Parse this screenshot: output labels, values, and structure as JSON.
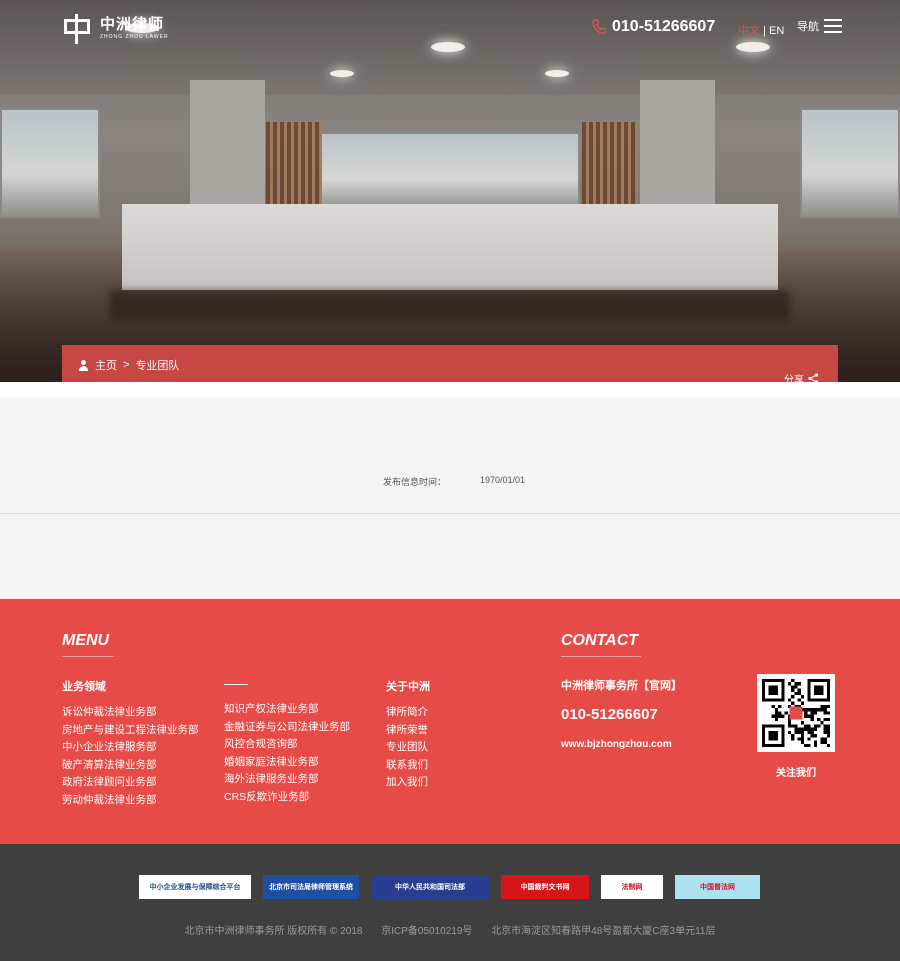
{
  "header": {
    "logo_cn": "中洲律师",
    "logo_en": "ZHONG ZHOU LAWER",
    "phone": "010-51266607",
    "lang_cn": "中文",
    "lang_sep": "|",
    "lang_en": "EN",
    "nav_label": "导航"
  },
  "breadcrumb": {
    "home": "主页",
    "sep": ">",
    "current": "专业团队",
    "share": "分享"
  },
  "content": {
    "publish_label": "发布信息时间：",
    "publish_date": "1970/01/01"
  },
  "footer": {
    "menu_title": "MENU",
    "contact_title": "CONTACT",
    "col1": {
      "title": "业务领域",
      "items": [
        "诉讼仲裁法律业务部",
        "房地产与建设工程法律业务部",
        "中小企业法律服务部",
        "破产清算法律业务部",
        "政府法律顾问业务部",
        "劳动仲裁法律业务部"
      ]
    },
    "col2": {
      "items": [
        "知识产权法律业务部",
        "金融证券与公司法律业务部",
        "风控合规咨询部",
        "婚姻家庭法律业务部",
        "海外法律服务业务部",
        "CRS反欺诈业务部"
      ]
    },
    "col3": {
      "title": "关于中洲",
      "items": [
        "律所简介",
        "律所荣誉",
        "专业团队",
        "联系我们",
        "加入我们"
      ]
    },
    "contact": {
      "name": "中洲律师事务所【官网】",
      "phone": "010-51266607",
      "website": "www.bjzhongzhou.com",
      "qr_label": "关注我们"
    }
  },
  "partner_links": [
    {
      "label": "中小企业发展与保障综合平台",
      "bg": "#ffffff",
      "fg": "#1e4f8f",
      "w": 112
    },
    {
      "label": "北京市司法局律师管理系统",
      "bg": "#1f4fa0",
      "fg": "#ffffff",
      "w": 96
    },
    {
      "label": "中华人民共和国司法部",
      "bg": "#2a3e8f",
      "fg": "#ffffff",
      "w": 118
    },
    {
      "label": "中国裁判文书网",
      "bg": "#d6151b",
      "fg": "#ffffff",
      "w": 88
    },
    {
      "label": "法制网",
      "bg": "#ffffff",
      "fg": "#c8161d",
      "w": 62
    },
    {
      "label": "中国普法网",
      "bg": "#aee1ef",
      "fg": "#c8161d",
      "w": 85
    }
  ],
  "copyright": {
    "owner": "北京市中洲律师事务所 版权所有 © 2018",
    "icp": "京ICP备05010219号",
    "address": "北京市海淀区知春路甲48号盈都大厦C座3单元11层"
  },
  "colors": {
    "brand_red": "#e64b48",
    "dark_footer": "#3f3f3f"
  }
}
